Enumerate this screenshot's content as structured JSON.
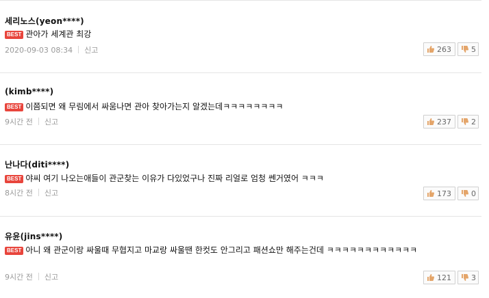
{
  "comments": [
    {
      "author": "세리노스(yeon****)",
      "badge": "BEST",
      "text": "관아가 세계관 최강",
      "time": "2020-09-03 08:34",
      "report_label": "신고",
      "likes": "263",
      "dislikes": "5"
    },
    {
      "author": "(kimb****)",
      "badge": "BEST",
      "text": "이쯤되면 왜 무림에서 싸움나면 관아 찾아가는지 알겠는데ㅋㅋㅋㅋㅋㅋㅋㅋ",
      "time": "9시간 전",
      "report_label": "신고",
      "likes": "237",
      "dislikes": "2"
    },
    {
      "author": "난나다(diti****)",
      "badge": "BEST",
      "text": "야씨 여기 나오는애들이 관군찾는 이유가 다있었구나 진짜 리얼로 엄청 쎈거였어 ㅋㅋㅋ",
      "time": "8시간 전",
      "report_label": "신고",
      "likes": "173",
      "dislikes": "0"
    },
    {
      "author": "유윤(jins****)",
      "badge": "BEST",
      "text": "아니 왜 관군이랑 싸울때 무협지고 마교랑 싸울땐 한컷도 안그리고 패션쇼만 해주는건데 ㅋㅋㅋㅋㅋㅋㅋㅋㅋㅋㅋㅋ",
      "time": "9시간 전",
      "report_label": "신고",
      "likes": "121",
      "dislikes": "3"
    }
  ],
  "icons": {
    "like": "thumbs-up-icon",
    "dislike": "thumbs-down-icon"
  },
  "colors": {
    "badge": "#e8453c",
    "thumb_up": "#e4a56a",
    "thumb_down": "#e4a56a"
  }
}
